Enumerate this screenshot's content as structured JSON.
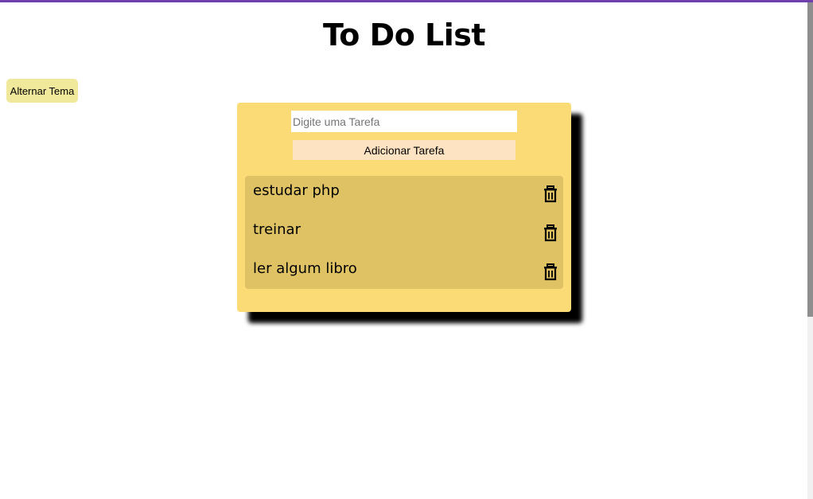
{
  "header": {
    "title": "To Do List"
  },
  "theme_toggle": {
    "label": "Alternar Tema"
  },
  "form": {
    "input_placeholder": "Digite uma Tarefa",
    "input_value": "",
    "add_label": "Adicionar Tarefa"
  },
  "tasks": [
    {
      "label": "estudar php",
      "delete_icon": "trash-icon"
    },
    {
      "label": "treinar",
      "delete_icon": "trash-icon"
    },
    {
      "label": "ler algum libro",
      "delete_icon": "trash-icon"
    }
  ],
  "colors": {
    "accent": "#6f3fb0",
    "card": "#fadb75",
    "list": "#dfc264",
    "theme_button": "#f0e89a",
    "add_button": "#fde3c2"
  }
}
